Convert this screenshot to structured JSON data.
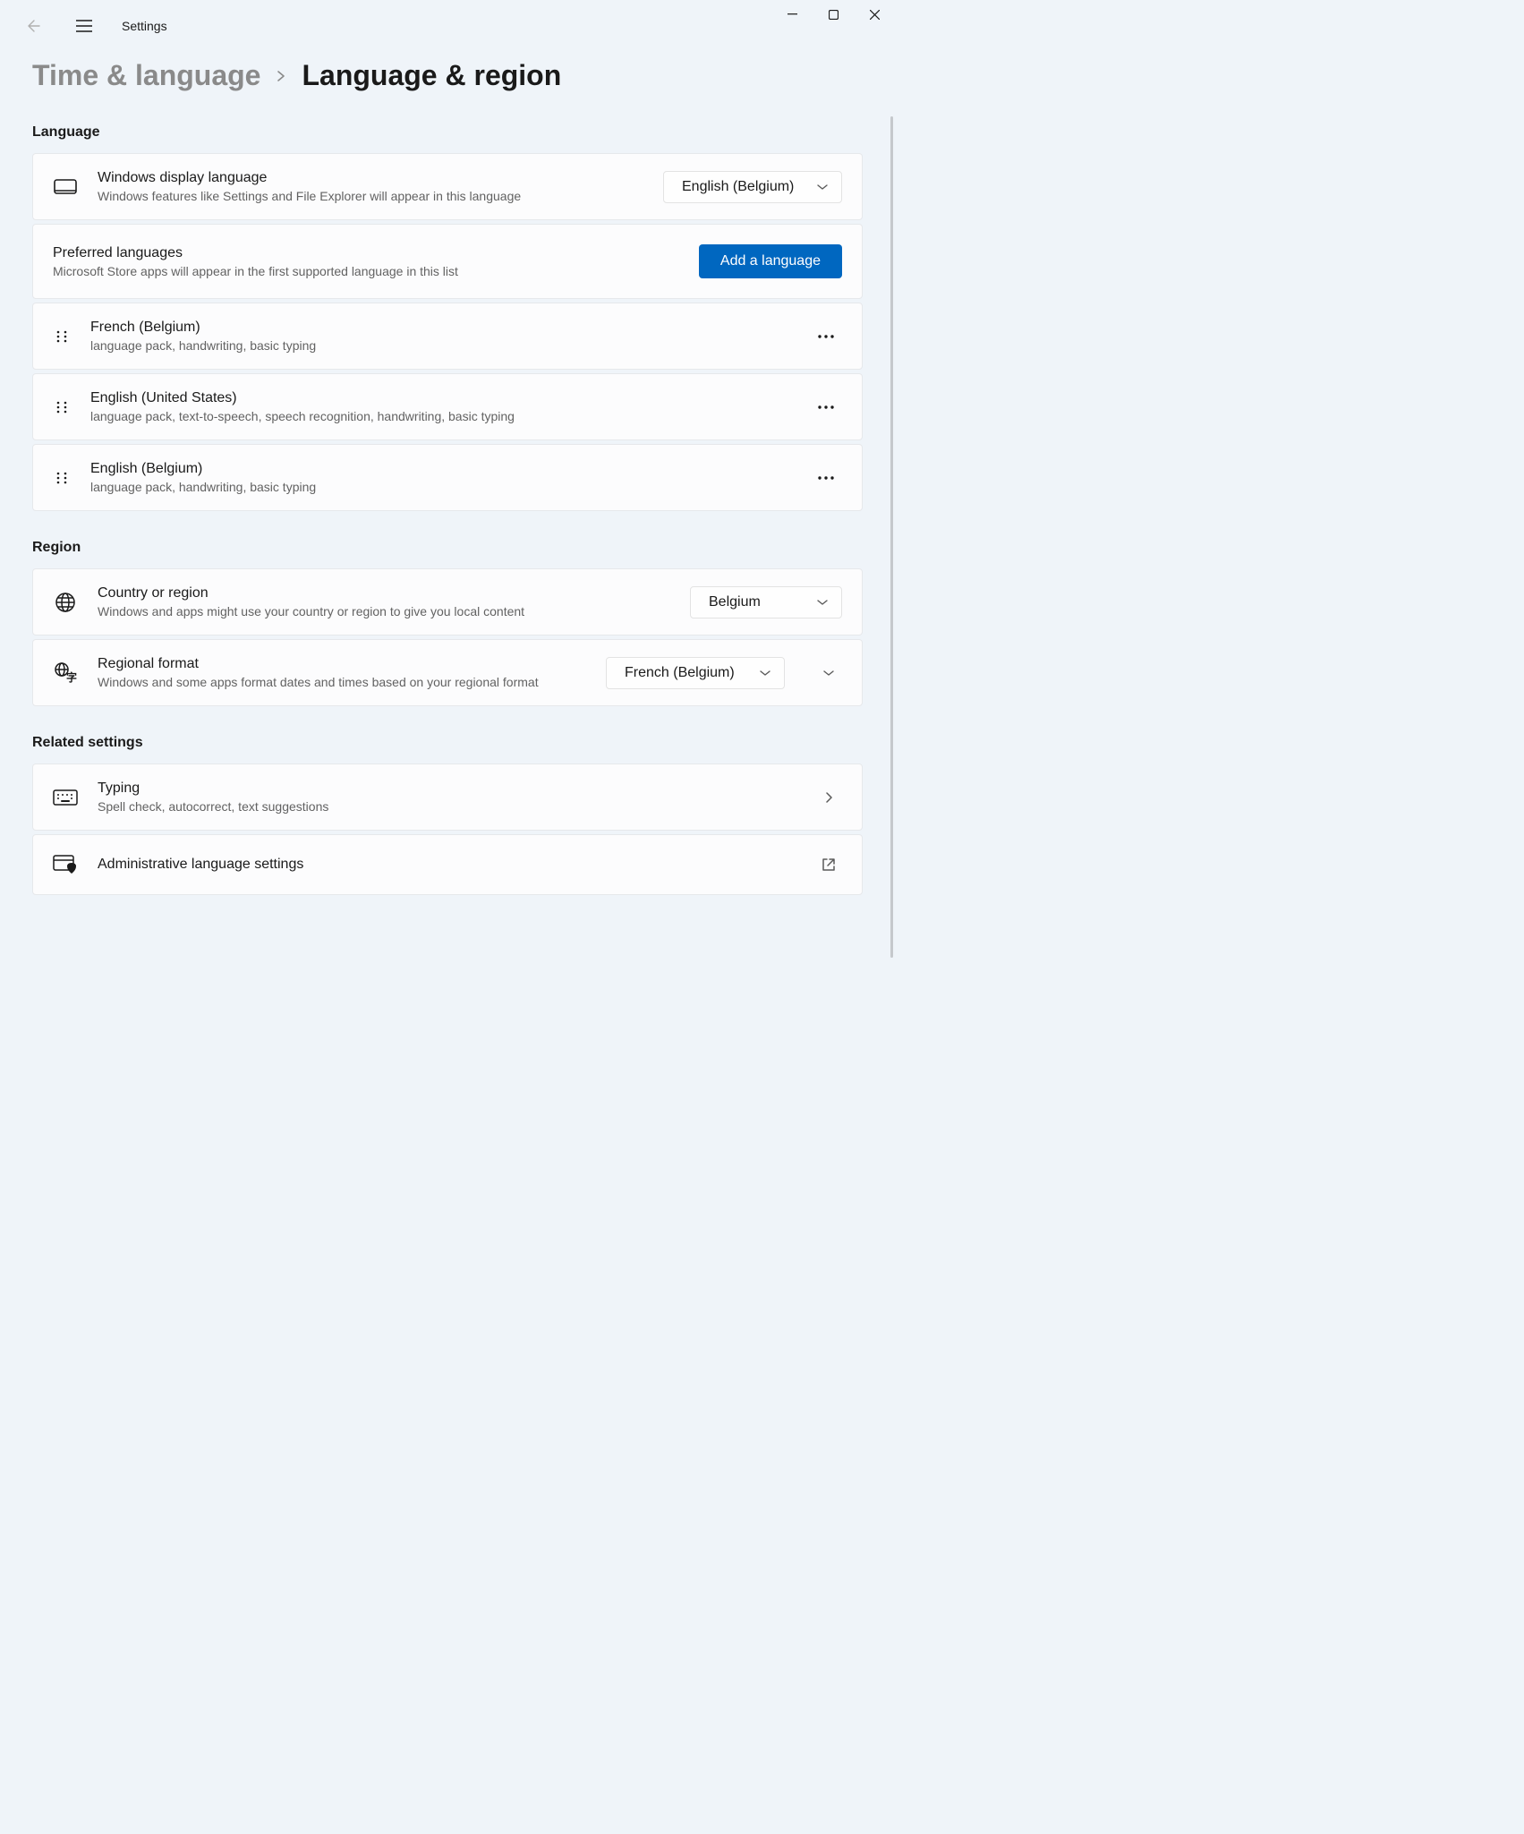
{
  "app_title": "Settings",
  "breadcrumb": {
    "parent": "Time & language",
    "current": "Language & region"
  },
  "sections": {
    "language": {
      "header": "Language",
      "display_language": {
        "title": "Windows display language",
        "subtitle": "Windows features like Settings and File Explorer will appear in this language",
        "value": "English (Belgium)"
      },
      "preferred_languages": {
        "title": "Preferred languages",
        "subtitle": "Microsoft Store apps will appear in the first supported language in this list",
        "add_button": "Add a language"
      },
      "language_list": [
        {
          "name": "French (Belgium)",
          "features": "language pack, handwriting, basic typing"
        },
        {
          "name": "English (United States)",
          "features": "language pack, text-to-speech, speech recognition, handwriting, basic typing"
        },
        {
          "name": "English (Belgium)",
          "features": "language pack, handwriting, basic typing"
        }
      ]
    },
    "region": {
      "header": "Region",
      "country": {
        "title": "Country or region",
        "subtitle": "Windows and apps might use your country or region to give you local content",
        "value": "Belgium"
      },
      "format": {
        "title": "Regional format",
        "subtitle": "Windows and some apps format dates and times based on your regional format",
        "value": "French (Belgium)"
      }
    },
    "related": {
      "header": "Related settings",
      "typing": {
        "title": "Typing",
        "subtitle": "Spell check, autocorrect, text suggestions"
      },
      "admin": {
        "title": "Administrative language settings"
      }
    }
  }
}
